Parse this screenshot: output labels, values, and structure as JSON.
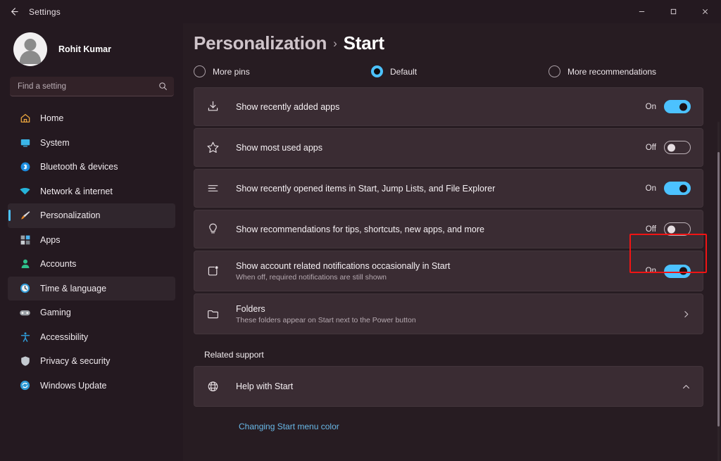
{
  "titlebar": {
    "back_label": "back-arrow",
    "title": "Settings",
    "minimize": "minimize",
    "maximize": "maximize",
    "close": "close"
  },
  "sidebar": {
    "account_name": "Rohit Kumar",
    "search": {
      "placeholder": "Find a setting",
      "value": ""
    },
    "items": [
      {
        "label": "Home",
        "icon": "home-icon",
        "state": "normal"
      },
      {
        "label": "System",
        "icon": "system-icon",
        "state": "normal"
      },
      {
        "label": "Bluetooth & devices",
        "icon": "bluetooth-icon",
        "state": "normal"
      },
      {
        "label": "Network & internet",
        "icon": "network-icon",
        "state": "normal"
      },
      {
        "label": "Personalization",
        "icon": "personalization-icon",
        "state": "selected"
      },
      {
        "label": "Apps",
        "icon": "apps-icon",
        "state": "normal"
      },
      {
        "label": "Accounts",
        "icon": "accounts-icon",
        "state": "normal"
      },
      {
        "label": "Time & language",
        "icon": "time-icon",
        "state": "hovered"
      },
      {
        "label": "Gaming",
        "icon": "gaming-icon",
        "state": "normal"
      },
      {
        "label": "Accessibility",
        "icon": "accessibility-icon",
        "state": "normal"
      },
      {
        "label": "Privacy & security",
        "icon": "privacy-icon",
        "state": "normal"
      },
      {
        "label": "Windows Update",
        "icon": "update-icon",
        "state": "normal"
      }
    ]
  },
  "header": {
    "breadcrumb_parent": "Personalization",
    "breadcrumb_separator": "›",
    "breadcrumb_current": "Start"
  },
  "layout_options": [
    {
      "label": "More pins",
      "checked": false
    },
    {
      "label": "Default",
      "checked": true
    },
    {
      "label": "More recommendations",
      "checked": false
    }
  ],
  "settings": [
    {
      "title": "Show recently added apps",
      "subtitle": "",
      "icon": "download-icon",
      "toggle_label": "On",
      "toggle_state": "on"
    },
    {
      "title": "Show most used apps",
      "subtitle": "",
      "icon": "star-icon",
      "toggle_label": "Off",
      "toggle_state": "off"
    },
    {
      "title": "Show recently opened items in Start, Jump Lists, and File Explorer",
      "subtitle": "",
      "icon": "list-icon",
      "toggle_label": "On",
      "toggle_state": "on"
    },
    {
      "title": "Show recommendations for tips, shortcuts, new apps, and more",
      "subtitle": "",
      "icon": "lightbulb-icon",
      "toggle_label": "Off",
      "toggle_state": "off",
      "highlighted": true
    },
    {
      "title": "Show account related notifications occasionally in Start",
      "subtitle": "When off, required notifications are still shown",
      "icon": "notification-icon",
      "toggle_label": "On",
      "toggle_state": "on"
    },
    {
      "title": "Folders",
      "subtitle": "These folders appear on Start next to the Power button",
      "icon": "folder-icon",
      "chevron": "chevron-right"
    }
  ],
  "related_support": {
    "label": "Related support",
    "help_title": "Help with Start",
    "help_icon": "globe-icon",
    "help_chevron": "chevron-up",
    "links": [
      "Changing Start menu color"
    ]
  },
  "colors": {
    "accent": "#4cc2ff",
    "page_bg": "#271c22",
    "sidebar_bg": "#241920",
    "card_bg": "#3a2c33",
    "annotation": "#f01414",
    "link": "#69b9e8"
  }
}
